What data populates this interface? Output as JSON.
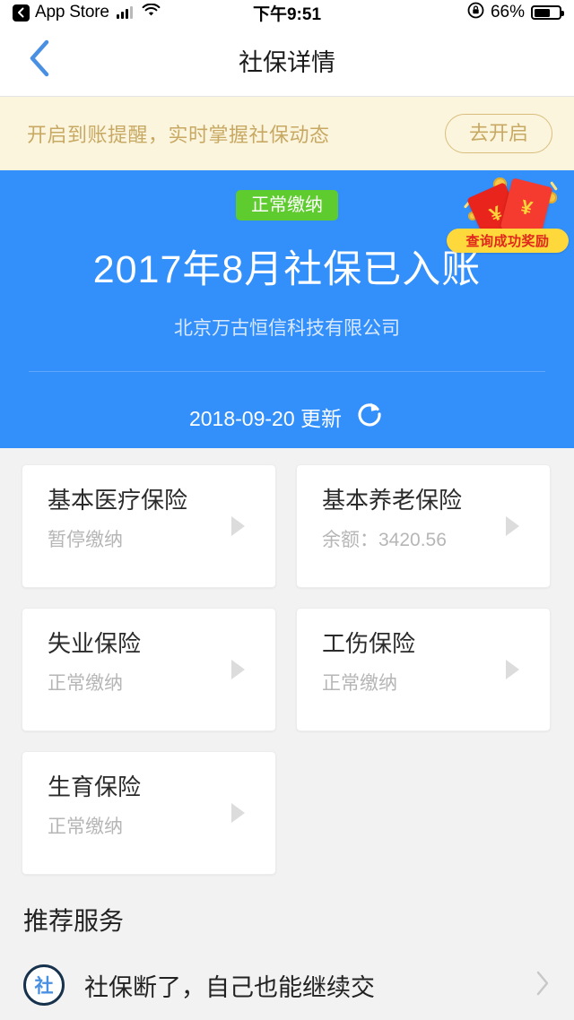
{
  "status_bar": {
    "back_app": "App Store",
    "time": "下午9:51",
    "battery_percent": "66%",
    "icons": [
      "back-badge-icon",
      "signal-bars-icon",
      "wifi-icon",
      "rotation-lock-icon",
      "battery-icon"
    ]
  },
  "nav": {
    "title": "社保详情",
    "back_icon": "chevron-left-icon"
  },
  "notice": {
    "text": "开启到账提醒，实时掌握社保动态",
    "button_label": "去开启"
  },
  "hero": {
    "badge": "正常缴纳",
    "title": "2017年8月社保已入账",
    "company": "北京万古恒信科技有限公司",
    "update_text": "2018-09-20 更新",
    "refresh_icon": "refresh-icon",
    "sticker_label": "查询成功奖励",
    "sticker_symbol": "¥",
    "background_color": "#3390fb",
    "badge_color": "#5ecb2e"
  },
  "cards": [
    {
      "title": "基本医疗保险",
      "sub": "暂停缴纳"
    },
    {
      "title": "基本养老保险",
      "sub": "余额：3420.56"
    },
    {
      "title": "失业保险",
      "sub": "正常缴纳"
    },
    {
      "title": "工伤保险",
      "sub": "正常缴纳"
    },
    {
      "title": "生育保险",
      "sub": "正常缴纳"
    }
  ],
  "recommend": {
    "title": "推荐服务",
    "items": [
      {
        "icon_text": "社",
        "label": "社保断了，自己也能继续交"
      }
    ]
  }
}
